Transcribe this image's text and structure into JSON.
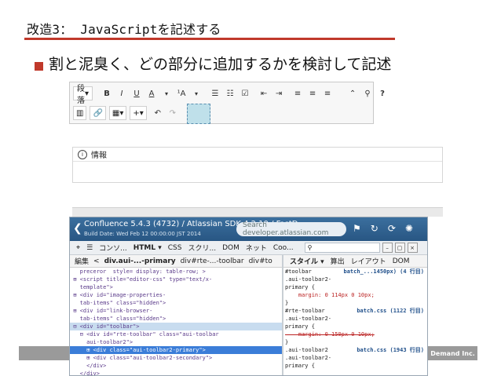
{
  "slide": {
    "title": "改造3： JavaScriptを記述する",
    "bullet": "割と泥臭く、どの部分に追加するかを検討して記述"
  },
  "editor_toolbar": {
    "paragraph_select": "段落",
    "bold": "B",
    "italic": "I",
    "underline": "U",
    "text_color": "A",
    "font_size": "¹A",
    "bullet_list": "☰",
    "numbered_list": "☷",
    "task_list": "☑",
    "outdent": "⇤",
    "indent": "⇥",
    "align_left": "≡",
    "align_center": "≡",
    "align_right": "≡",
    "chevrons": "⌃",
    "search": "⚲",
    "help": "?",
    "layout_btn": "▥",
    "link_btn": "🔗",
    "table_btn": "▦",
    "insert_btn": "+",
    "undo": "↶",
    "redo": "↷"
  },
  "info_panel": {
    "label": "情報",
    "icon": "i"
  },
  "devtools": {
    "window_title": "Confluence 5.4.3 (4732) / Atlassian SDK 4.2.10 / FastD",
    "build_date": "Build Date: Wed Feb 12 00:00:00 JST 2014",
    "search_placeholder": "Search developer.atlassian.com",
    "tabs": [
      "コンソ...",
      "HTML ▾",
      "CSS",
      "スクリ...",
      "DOM",
      "ネット",
      "Coo..."
    ],
    "edit_label": "編集",
    "breadcrumb": [
      "div.aui-...-primary",
      "div#rte-...-toolbar",
      "div#to"
    ],
    "side_tabs": [
      "スタイル ▾",
      "算出",
      "レイアウト",
      "DOM"
    ],
    "html_lines": [
      "   preceror  style= display: table-row; >",
      " ⊞ <script title=\"editor-css\" type=\"text/x-",
      "   template\">",
      " ⊞ <div id=\"image-properties-",
      "   tab-items\" class=\"hidden\">",
      " ⊞ <div id=\"link-browser-",
      "   tab-items\" class=\"hidden\">",
      " ⊟ <div id=\"toolbar\">",
      "   ⊟ <div id=\"rte-toolbar\" class=\"aui-toolbar",
      "     aui-toolbar2\">",
      "     ⊞ <div class=\"aui-toolbar2-primary\">",
      "     ⊞ <div class=\"aui-toolbar2-secondary\">",
      "     </div>",
      "   </div>"
    ],
    "css_rules": [
      {
        "selector": "#toolbar",
        "source": "batch_...1450px) (4 行目)"
      },
      {
        "selector": ".aui-toolbar2-",
        "source": ""
      },
      {
        "selector": "primary {",
        "source": ""
      },
      {
        "selector": "    margin: 0 114px 0 10px;",
        "source": ""
      },
      {
        "selector": "}",
        "source": ""
      },
      {
        "selector": "#rte-toolbar",
        "source": "batch.css (1122 行目)"
      },
      {
        "selector": ".aui-toolbar2-",
        "source": ""
      },
      {
        "selector": "primary {",
        "source": ""
      },
      {
        "selector": "    margin: 0 150px 0 10px;",
        "source": ""
      },
      {
        "selector": "}",
        "source": ""
      },
      {
        "selector": ".aui-toolbar2",
        "source": "batch.css (1943 行目)"
      },
      {
        "selector": ".aui-toolbar2-",
        "source": ""
      },
      {
        "selector": "primary {",
        "source": ""
      }
    ]
  },
  "footer": {
    "company": "Demand Inc."
  }
}
